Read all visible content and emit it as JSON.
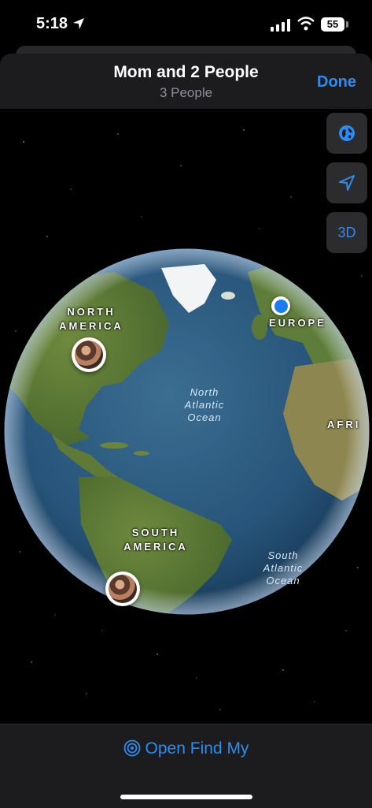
{
  "status": {
    "time": "5:18",
    "battery": "55"
  },
  "header": {
    "title": "Mom and 2 People",
    "subtitle": "3 People",
    "done_label": "Done"
  },
  "map_controls": {
    "three_d_label": "3D"
  },
  "map": {
    "labels": {
      "north_america_1": "NORTH",
      "north_america_2": "AMERICA",
      "south_america_1": "SOUTH",
      "south_america_2": "AMERICA",
      "europe": "EUROPE",
      "africa": "AFRI",
      "north_atlantic_1": "North",
      "north_atlantic_2": "Atlantic",
      "north_atlantic_3": "Ocean",
      "south_atlantic_1": "South",
      "south_atlantic_2": "Atlantic",
      "south_atlantic_3": "Ocean"
    }
  },
  "footer": {
    "open_label": "Open Find My"
  },
  "colors": {
    "accent": "#2e8cf0",
    "background": "#000000",
    "panel": "#1c1c1e"
  }
}
